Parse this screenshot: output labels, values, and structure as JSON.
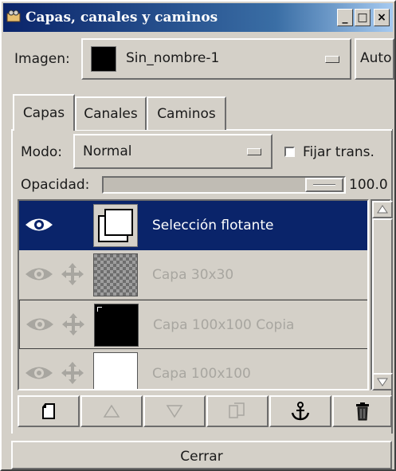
{
  "window": {
    "title": "Capas, canales y caminos",
    "controls": [
      "_",
      "□",
      "×"
    ]
  },
  "image_selector": {
    "label": "Imagen:",
    "value": "Sin_nombre-1",
    "auto_label": "Auto"
  },
  "tabs": [
    {
      "label": "Capas",
      "active": true
    },
    {
      "label": "Canales",
      "active": false
    },
    {
      "label": "Caminos",
      "active": false
    }
  ],
  "mode": {
    "label": "Modo:",
    "value": "Normal",
    "fix_trans_label": "Fijar trans.",
    "fix_trans_checked": false
  },
  "opacity": {
    "label": "Opacidad:",
    "value": "100.0",
    "fraction": 1.0
  },
  "layers": [
    {
      "name": "Selección flotante",
      "visible": true,
      "linked": false,
      "selected": true,
      "thumb": "floating-selection",
      "dimmed": false
    },
    {
      "name": "Capa 30x30",
      "visible": false,
      "linked": false,
      "selected": false,
      "thumb": "transparent",
      "dimmed": true
    },
    {
      "name": "Capa 100x100 Copia",
      "visible": false,
      "linked": false,
      "selected": false,
      "thumb": "black",
      "dimmed": true
    },
    {
      "name": "Capa 100x100",
      "visible": false,
      "linked": false,
      "selected": false,
      "thumb": "white",
      "dimmed": true
    }
  ],
  "layer_tools": [
    {
      "icon": "new-layer-icon",
      "enabled": true
    },
    {
      "icon": "raise-layer-icon",
      "enabled": false
    },
    {
      "icon": "lower-layer-icon",
      "enabled": false
    },
    {
      "icon": "duplicate-layer-icon",
      "enabled": false
    },
    {
      "icon": "anchor-layer-icon",
      "enabled": true
    },
    {
      "icon": "delete-layer-icon",
      "enabled": true
    }
  ],
  "close_label": "Cerrar",
  "colors": {
    "selection_bg": "#0a246a",
    "selection_text": "#ffffff",
    "dialog_bg": "#d4d0c8",
    "disabled_text": "#a8a6a0"
  }
}
